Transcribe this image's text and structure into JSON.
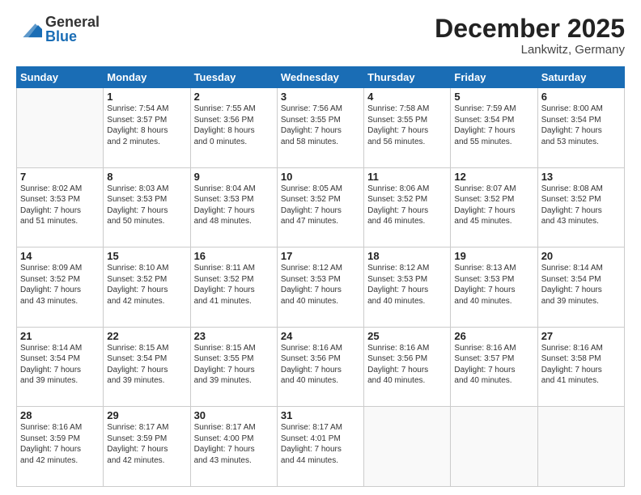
{
  "header": {
    "logo": {
      "general": "General",
      "blue": "Blue"
    },
    "title": "December 2025",
    "location": "Lankwitz, Germany"
  },
  "weekdays": [
    "Sunday",
    "Monday",
    "Tuesday",
    "Wednesday",
    "Thursday",
    "Friday",
    "Saturday"
  ],
  "weeks": [
    [
      {
        "day": "",
        "info": ""
      },
      {
        "day": "1",
        "info": "Sunrise: 7:54 AM\nSunset: 3:57 PM\nDaylight: 8 hours\nand 2 minutes."
      },
      {
        "day": "2",
        "info": "Sunrise: 7:55 AM\nSunset: 3:56 PM\nDaylight: 8 hours\nand 0 minutes."
      },
      {
        "day": "3",
        "info": "Sunrise: 7:56 AM\nSunset: 3:55 PM\nDaylight: 7 hours\nand 58 minutes."
      },
      {
        "day": "4",
        "info": "Sunrise: 7:58 AM\nSunset: 3:55 PM\nDaylight: 7 hours\nand 56 minutes."
      },
      {
        "day": "5",
        "info": "Sunrise: 7:59 AM\nSunset: 3:54 PM\nDaylight: 7 hours\nand 55 minutes."
      },
      {
        "day": "6",
        "info": "Sunrise: 8:00 AM\nSunset: 3:54 PM\nDaylight: 7 hours\nand 53 minutes."
      }
    ],
    [
      {
        "day": "7",
        "info": "Sunrise: 8:02 AM\nSunset: 3:53 PM\nDaylight: 7 hours\nand 51 minutes."
      },
      {
        "day": "8",
        "info": "Sunrise: 8:03 AM\nSunset: 3:53 PM\nDaylight: 7 hours\nand 50 minutes."
      },
      {
        "day": "9",
        "info": "Sunrise: 8:04 AM\nSunset: 3:53 PM\nDaylight: 7 hours\nand 48 minutes."
      },
      {
        "day": "10",
        "info": "Sunrise: 8:05 AM\nSunset: 3:52 PM\nDaylight: 7 hours\nand 47 minutes."
      },
      {
        "day": "11",
        "info": "Sunrise: 8:06 AM\nSunset: 3:52 PM\nDaylight: 7 hours\nand 46 minutes."
      },
      {
        "day": "12",
        "info": "Sunrise: 8:07 AM\nSunset: 3:52 PM\nDaylight: 7 hours\nand 45 minutes."
      },
      {
        "day": "13",
        "info": "Sunrise: 8:08 AM\nSunset: 3:52 PM\nDaylight: 7 hours\nand 43 minutes."
      }
    ],
    [
      {
        "day": "14",
        "info": "Sunrise: 8:09 AM\nSunset: 3:52 PM\nDaylight: 7 hours\nand 43 minutes."
      },
      {
        "day": "15",
        "info": "Sunrise: 8:10 AM\nSunset: 3:52 PM\nDaylight: 7 hours\nand 42 minutes."
      },
      {
        "day": "16",
        "info": "Sunrise: 8:11 AM\nSunset: 3:52 PM\nDaylight: 7 hours\nand 41 minutes."
      },
      {
        "day": "17",
        "info": "Sunrise: 8:12 AM\nSunset: 3:53 PM\nDaylight: 7 hours\nand 40 minutes."
      },
      {
        "day": "18",
        "info": "Sunrise: 8:12 AM\nSunset: 3:53 PM\nDaylight: 7 hours\nand 40 minutes."
      },
      {
        "day": "19",
        "info": "Sunrise: 8:13 AM\nSunset: 3:53 PM\nDaylight: 7 hours\nand 40 minutes."
      },
      {
        "day": "20",
        "info": "Sunrise: 8:14 AM\nSunset: 3:54 PM\nDaylight: 7 hours\nand 39 minutes."
      }
    ],
    [
      {
        "day": "21",
        "info": "Sunrise: 8:14 AM\nSunset: 3:54 PM\nDaylight: 7 hours\nand 39 minutes."
      },
      {
        "day": "22",
        "info": "Sunrise: 8:15 AM\nSunset: 3:54 PM\nDaylight: 7 hours\nand 39 minutes."
      },
      {
        "day": "23",
        "info": "Sunrise: 8:15 AM\nSunset: 3:55 PM\nDaylight: 7 hours\nand 39 minutes."
      },
      {
        "day": "24",
        "info": "Sunrise: 8:16 AM\nSunset: 3:56 PM\nDaylight: 7 hours\nand 40 minutes."
      },
      {
        "day": "25",
        "info": "Sunrise: 8:16 AM\nSunset: 3:56 PM\nDaylight: 7 hours\nand 40 minutes."
      },
      {
        "day": "26",
        "info": "Sunrise: 8:16 AM\nSunset: 3:57 PM\nDaylight: 7 hours\nand 40 minutes."
      },
      {
        "day": "27",
        "info": "Sunrise: 8:16 AM\nSunset: 3:58 PM\nDaylight: 7 hours\nand 41 minutes."
      }
    ],
    [
      {
        "day": "28",
        "info": "Sunrise: 8:16 AM\nSunset: 3:59 PM\nDaylight: 7 hours\nand 42 minutes."
      },
      {
        "day": "29",
        "info": "Sunrise: 8:17 AM\nSunset: 3:59 PM\nDaylight: 7 hours\nand 42 minutes."
      },
      {
        "day": "30",
        "info": "Sunrise: 8:17 AM\nSunset: 4:00 PM\nDaylight: 7 hours\nand 43 minutes."
      },
      {
        "day": "31",
        "info": "Sunrise: 8:17 AM\nSunset: 4:01 PM\nDaylight: 7 hours\nand 44 minutes."
      },
      {
        "day": "",
        "info": ""
      },
      {
        "day": "",
        "info": ""
      },
      {
        "day": "",
        "info": ""
      }
    ]
  ]
}
